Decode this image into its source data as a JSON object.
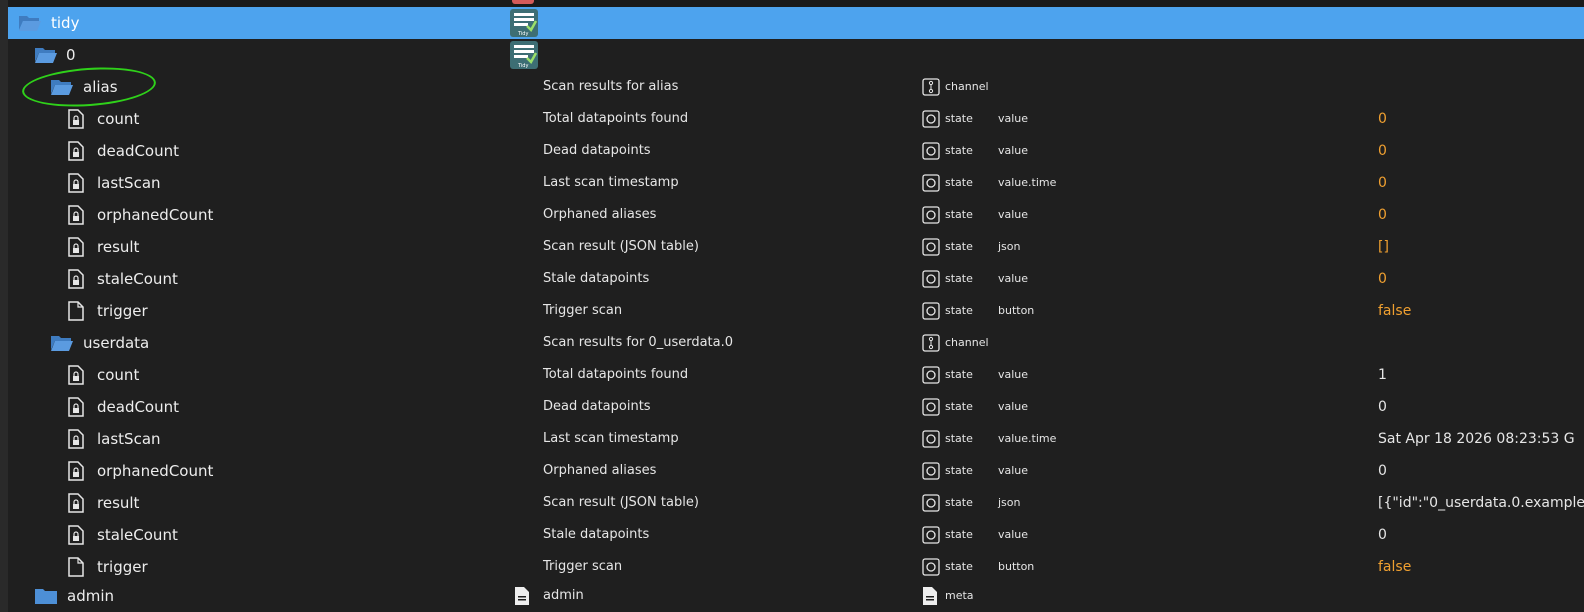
{
  "accent": "#4da3ee",
  "value_color_orange": "#f0a030",
  "annotation_color": "#2fd11a",
  "rows": [
    {
      "name": "tidy",
      "desc": "",
      "type": "",
      "role": "",
      "value": "",
      "icon": "folder-open-icon"
    },
    {
      "name": "0",
      "desc": "",
      "type": "",
      "role": "",
      "value": "",
      "icon": "folder-open-icon"
    },
    {
      "name": "alias",
      "desc": "Scan results for alias",
      "type": "channel",
      "role": "",
      "value": "",
      "icon": "folder-open-icon"
    },
    {
      "name": "count",
      "desc": "Total datapoints found",
      "type": "state",
      "role": "value",
      "value": "0",
      "icon": "locked-file-icon"
    },
    {
      "name": "deadCount",
      "desc": "Dead datapoints",
      "type": "state",
      "role": "value",
      "value": "0",
      "icon": "locked-file-icon"
    },
    {
      "name": "lastScan",
      "desc": "Last scan timestamp",
      "type": "state",
      "role": "value.time",
      "value": "0",
      "icon": "locked-file-icon"
    },
    {
      "name": "orphanedCount",
      "desc": "Orphaned aliases",
      "type": "state",
      "role": "value",
      "value": "0",
      "icon": "locked-file-icon"
    },
    {
      "name": "result",
      "desc": "Scan result (JSON table)",
      "type": "state",
      "role": "json",
      "value": "[]",
      "icon": "locked-file-icon"
    },
    {
      "name": "staleCount",
      "desc": "Stale datapoints",
      "type": "state",
      "role": "value",
      "value": "0",
      "icon": "locked-file-icon"
    },
    {
      "name": "trigger",
      "desc": "Trigger scan",
      "type": "state",
      "role": "button",
      "value": "false",
      "icon": "file-icon"
    },
    {
      "name": "userdata",
      "desc": "Scan results for 0_userdata.0",
      "type": "channel",
      "role": "",
      "value": "",
      "icon": "folder-open-icon"
    },
    {
      "name": "count",
      "desc": "Total datapoints found",
      "type": "state",
      "role": "value",
      "value": "1",
      "icon": "locked-file-icon"
    },
    {
      "name": "deadCount",
      "desc": "Dead datapoints",
      "type": "state",
      "role": "value",
      "value": "0",
      "icon": "locked-file-icon"
    },
    {
      "name": "lastScan",
      "desc": "Last scan timestamp",
      "type": "state",
      "role": "value.time",
      "value": "Sat Apr 18 2026 08:23:53 G",
      "icon": "locked-file-icon"
    },
    {
      "name": "orphanedCount",
      "desc": "Orphaned aliases",
      "type": "state",
      "role": "value",
      "value": "0",
      "icon": "locked-file-icon"
    },
    {
      "name": "result",
      "desc": "Scan result (JSON table)",
      "type": "state",
      "role": "json",
      "value": "[{\"id\":\"0_userdata.0.example",
      "icon": "locked-file-icon"
    },
    {
      "name": "staleCount",
      "desc": "Stale datapoints",
      "type": "state",
      "role": "value",
      "value": "0",
      "icon": "locked-file-icon"
    },
    {
      "name": "trigger",
      "desc": "Trigger scan",
      "type": "state",
      "role": "button",
      "value": "false",
      "icon": "file-icon"
    },
    {
      "name": "admin",
      "desc": "admin",
      "type": "meta",
      "role": "",
      "value": "",
      "icon": "folder-closed-icon"
    }
  ],
  "adapter_icon_label": "Tidy"
}
